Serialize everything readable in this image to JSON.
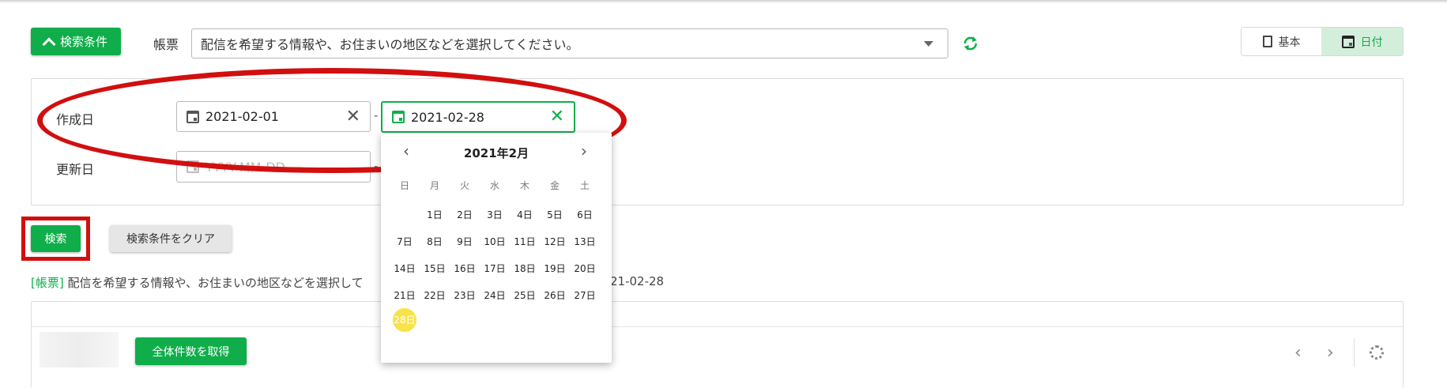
{
  "search_toggle": {
    "label": "検索条件",
    "expanded": true
  },
  "form_select": {
    "label": "帳票",
    "value": "配信を希望する情報や、お住まいの地区などを選択してください。"
  },
  "view_toggle": {
    "options": [
      "基本",
      "日付"
    ],
    "selected": "日付"
  },
  "created_date": {
    "label": "作成日",
    "from": "2021-02-01",
    "to": "2021-02-28"
  },
  "updated_date": {
    "label": "更新日",
    "from_placeholder": "YYYY-MM-DD"
  },
  "range_separator": "-",
  "calendar": {
    "month_label": "2021年2月",
    "weekdays": [
      "日",
      "月",
      "火",
      "水",
      "木",
      "金",
      "土"
    ],
    "weeks": [
      [
        "",
        "1日",
        "2日",
        "3日",
        "4日",
        "5日",
        "6日"
      ],
      [
        "7日",
        "8日",
        "9日",
        "10日",
        "11日",
        "12日",
        "13日"
      ],
      [
        "14日",
        "15日",
        "16日",
        "17日",
        "18日",
        "19日",
        "20日"
      ],
      [
        "21日",
        "22日",
        "23日",
        "24日",
        "25日",
        "26日",
        "27日"
      ],
      [
        "28日",
        "",
        "",
        "",
        "",
        "",
        ""
      ]
    ],
    "selected_day": "28日"
  },
  "actions": {
    "search": "検索",
    "clear": "検索条件をクリア"
  },
  "result_summary": {
    "tag": "[帳票]",
    "text": "配信を希望する情報や、お住まいの地区などを選択して",
    "tail": "21-02-28"
  },
  "toolbar": {
    "get_total": "全体件数を取得"
  },
  "colors": {
    "accent": "#0fae4a",
    "annotation": "#d10f0f",
    "highlight": "#f7e34a"
  }
}
